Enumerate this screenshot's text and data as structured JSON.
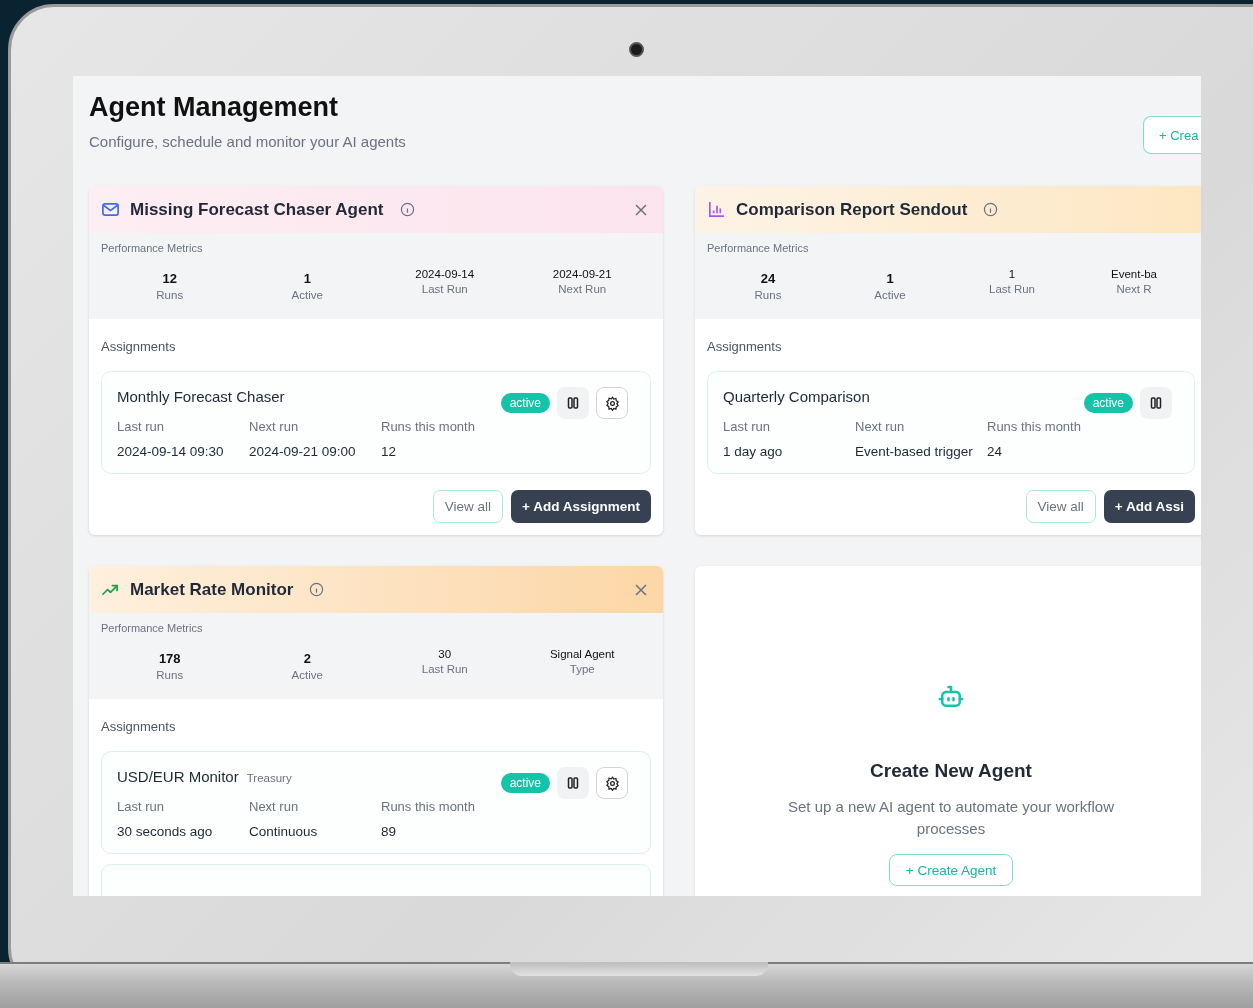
{
  "header": {
    "title": "Agent Management",
    "subtitle": "Configure, schedule and monitor your AI agents",
    "create_button": "+ Crea"
  },
  "left_column": [
    {
      "kind": "mail",
      "name": "Missing Forecast Chaser Agent",
      "closable": true,
      "metrics_label": "Performance Metrics",
      "metrics": [
        {
          "kind": "count",
          "value": "12",
          "label": "Runs"
        },
        {
          "kind": "count",
          "value": "1",
          "label": "Active"
        },
        {
          "kind": "text",
          "value": "2024-09-14",
          "label": "Last Run"
        },
        {
          "kind": "text",
          "value": "2024-09-21",
          "label": "Next Run"
        }
      ],
      "assignments_label": "Assignments",
      "assignments": [
        {
          "name": "Monthly Forecast Chaser",
          "status": "active",
          "controls": [
            {
              "kind": "pause"
            },
            {
              "kind": "settings"
            }
          ],
          "fields": [
            {
              "label": "Last run",
              "value": "2024-09-14 09:30"
            },
            {
              "label": "Next run",
              "value": "2024-09-21 09:00"
            },
            {
              "label": "Runs this month",
              "value": "12"
            }
          ]
        }
      ],
      "cut_off_assignment": false,
      "footer_buttons": [
        {
          "kind": "outline",
          "label": "View all"
        },
        {
          "kind": "solid",
          "label": "+ Add Assignment"
        }
      ]
    },
    {
      "kind": "trend",
      "name": "Market Rate Monitor",
      "closable": true,
      "metrics_label": "Performance Metrics",
      "metrics": [
        {
          "kind": "count",
          "value": "178",
          "label": "Runs"
        },
        {
          "kind": "count",
          "value": "2",
          "label": "Active"
        },
        {
          "kind": "text",
          "value": "30",
          "label": "Last Run"
        },
        {
          "kind": "text",
          "value": "Signal Agent",
          "label": "Type"
        }
      ],
      "assignments_label": "Assignments",
      "assignments": [
        {
          "name": "USD/EUR Monitor",
          "tag": "Treasury",
          "status": "active",
          "controls": [
            {
              "kind": "pause"
            },
            {
              "kind": "settings"
            }
          ],
          "fields": [
            {
              "label": "Last run",
              "value": "30 seconds ago"
            },
            {
              "label": "Next run",
              "value": "Continuous"
            },
            {
              "label": "Runs this month",
              "value": "89"
            }
          ]
        }
      ],
      "cut_off_assignment": true
    }
  ],
  "right_column": [
    {
      "kind": "chart",
      "name": "Comparison Report Sendout",
      "closable": false,
      "metrics_label": "Performance Metrics",
      "metrics": [
        {
          "kind": "count",
          "value": "24",
          "label": "Runs"
        },
        {
          "kind": "count",
          "value": "1",
          "label": "Active"
        },
        {
          "kind": "text",
          "value": "1",
          "label": "Last Run"
        },
        {
          "kind": "text",
          "value": "Event-ba",
          "label": "Next R"
        }
      ],
      "assignments_label": "Assignments",
      "assignments": [
        {
          "name": "Quarterly Comparison",
          "status": "active",
          "controls": [
            {
              "kind": "pause"
            }
          ],
          "fields": [
            {
              "label": "Last run",
              "value": "1 day ago"
            },
            {
              "label": "Next run",
              "value": "Event-based trigger"
            },
            {
              "label": "Runs this month",
              "value": "24"
            }
          ]
        }
      ],
      "cut_off_assignment": false,
      "footer_buttons": [
        {
          "kind": "outline",
          "label": "View all"
        },
        {
          "kind": "solid",
          "label": "+ Add Assi"
        }
      ]
    }
  ],
  "create_card": {
    "title": "Create New Agent",
    "description": "Set up a new AI agent to automate your workflow processes",
    "button": "+ Create Agent"
  }
}
